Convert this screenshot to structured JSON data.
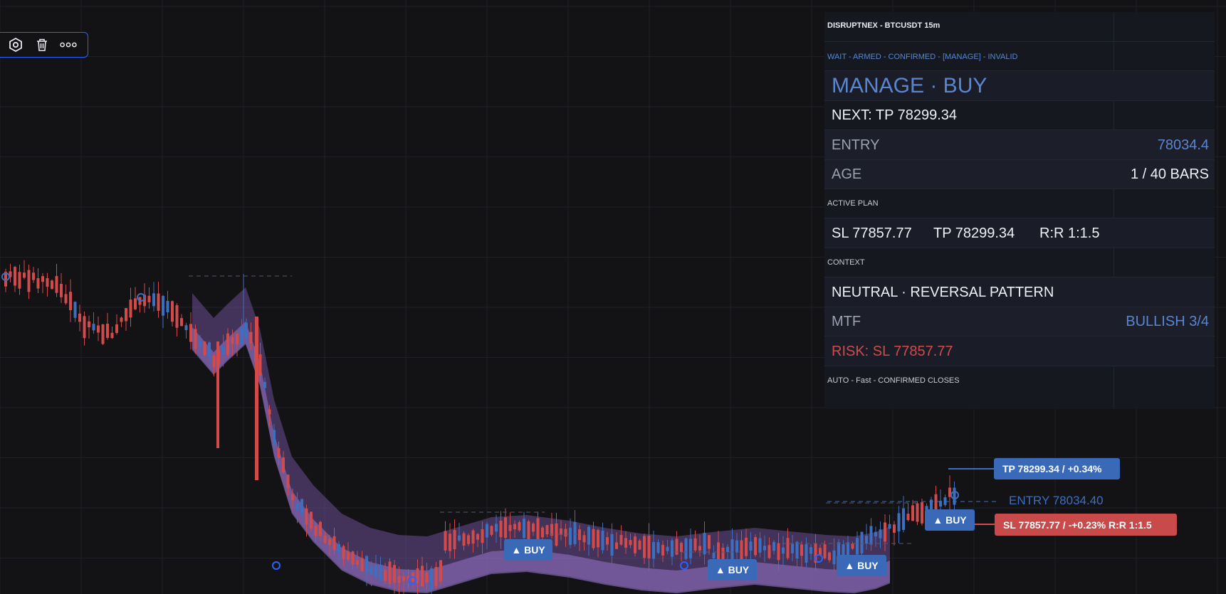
{
  "toolbar": {
    "icons": [
      "settings-icon",
      "trash-icon",
      "more-icon"
    ]
  },
  "panel": {
    "header": "DISRUPTNEX - BTCUSDT 15m",
    "states": "WAIT - ARMED - CONFIRMED - [MANAGE] - INVALID",
    "title": "MANAGE · BUY",
    "next": "NEXT: TP 78299.34",
    "entry_label": "ENTRY",
    "entry_value": "78034.4",
    "age_label": "AGE",
    "age_value": "1 / 40 BARS",
    "active_plan_label": "ACTIVE PLAN",
    "sl": "SL 77857.77",
    "tp": "TP 78299.34",
    "rr": "R:R 1:1.5",
    "context_label": "CONTEXT",
    "context_value": "NEUTRAL · REVERSAL PATTERN",
    "mtf_label": "MTF",
    "mtf_value": "BULLISH 3/4",
    "risk": "RISK: SL 77857.77",
    "footer": "AUTO - Fast - CONFIRMED CLOSES"
  },
  "levels": {
    "tp_tag": "TP  78299.34 / +0.34%",
    "entry_tag": "ENTRY  78034.40",
    "sl_tag": "SL  77857.77 / -+0.23%   R:R 1:1.5"
  },
  "signals": [
    "▲ BUY",
    "▲ BUY",
    "▲ BUY",
    "▲ BUY"
  ],
  "colors": {
    "background": "#131316",
    "bull": "#3d6fc0",
    "bear": "#d24a4a",
    "band": "#7a5ba5",
    "accent_blue": "#5a86d0",
    "risk_red": "#d24a4a"
  }
}
